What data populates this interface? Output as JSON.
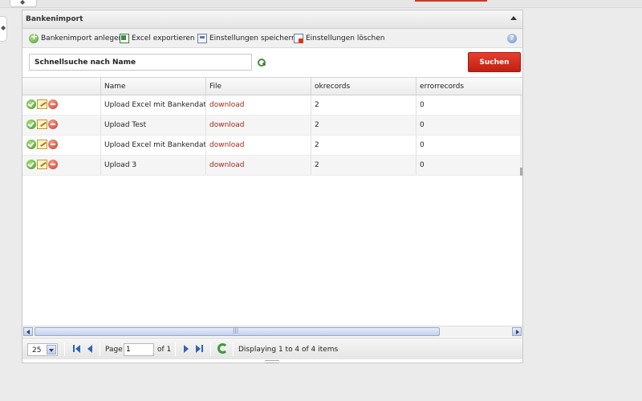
{
  "panel": {
    "title": "Bankenimport"
  },
  "toolbar": {
    "add_label": "Bankenimport anlegen",
    "export_label": "Excel exportieren",
    "save_settings_label": "Einstellungen speichern",
    "delete_settings_label": "Einstellungen löschen"
  },
  "search": {
    "value": "Schnellsuche nach Name",
    "button_label": "Suchen"
  },
  "grid": {
    "columns": [
      "",
      "Name",
      "File",
      "okrecords",
      "errorrecords"
    ],
    "rows": [
      {
        "name": "Upload Excel mit Bankendaten",
        "file": "download",
        "okrecords": "2",
        "errorrecords": "0"
      },
      {
        "name": "Upload Test",
        "file": "download",
        "okrecords": "2",
        "errorrecords": "0"
      },
      {
        "name": "Upload Excel mit Bankendaten",
        "file": "download",
        "okrecords": "2",
        "errorrecords": "0"
      },
      {
        "name": "Upload 3",
        "file": "download",
        "okrecords": "2",
        "errorrecords": "0"
      }
    ],
    "row_icons": [
      "ok-icon",
      "edit-icon",
      "delete-icon"
    ]
  },
  "paging": {
    "page_size": "25",
    "page_label": "Page",
    "page_value": "1",
    "of_label": "of 1",
    "status": "Displaying 1 to 4 of 4 items"
  },
  "scrollbar": {
    "thumb_grip": "|||"
  },
  "colors": {
    "search_button": "#cf2a1a",
    "download_link": "#a02a1c"
  }
}
